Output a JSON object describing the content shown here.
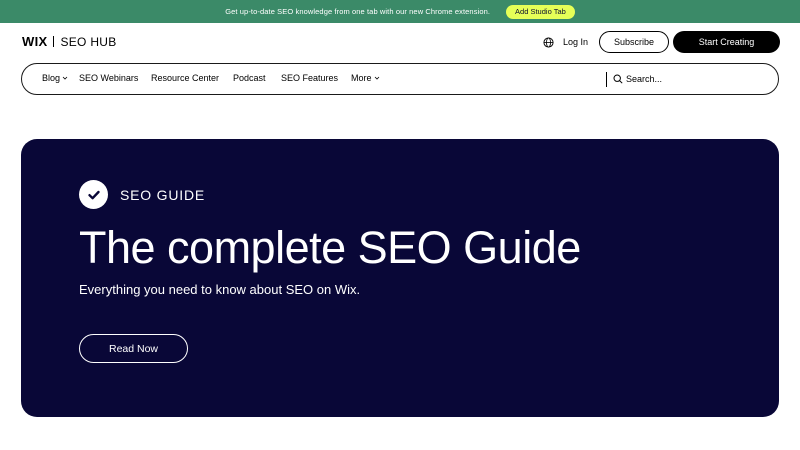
{
  "promo": {
    "text": "Get up-to-date SEO knowledge from one tab with our new Chrome extension.",
    "button_label": "Add Studio Tab",
    "accent_color": "#3b8a68",
    "button_color": "#e6ff57"
  },
  "header": {
    "logo_brand": "WIX",
    "logo_product": "SEO HUB",
    "login_label": "Log In",
    "subscribe_label": "Subscribe",
    "start_label": "Start Creating",
    "globe_icon": "globe-icon"
  },
  "nav": {
    "items": [
      {
        "label": "Blog",
        "has_dropdown": true
      },
      {
        "label": "SEO Webinars",
        "has_dropdown": false
      },
      {
        "label": "Resource Center",
        "has_dropdown": false
      },
      {
        "label": "Podcast",
        "has_dropdown": false
      },
      {
        "label": "SEO Features",
        "has_dropdown": false
      },
      {
        "label": "More",
        "has_dropdown": true
      }
    ],
    "search_placeholder": "Search..."
  },
  "hero": {
    "background_color": "#090737",
    "badge_icon": "checkmark-icon",
    "eyebrow": "SEO GUIDE",
    "title": "The complete SEO Guide",
    "subtitle": "Everything you need to know about SEO on Wix.",
    "cta_label": "Read Now"
  }
}
